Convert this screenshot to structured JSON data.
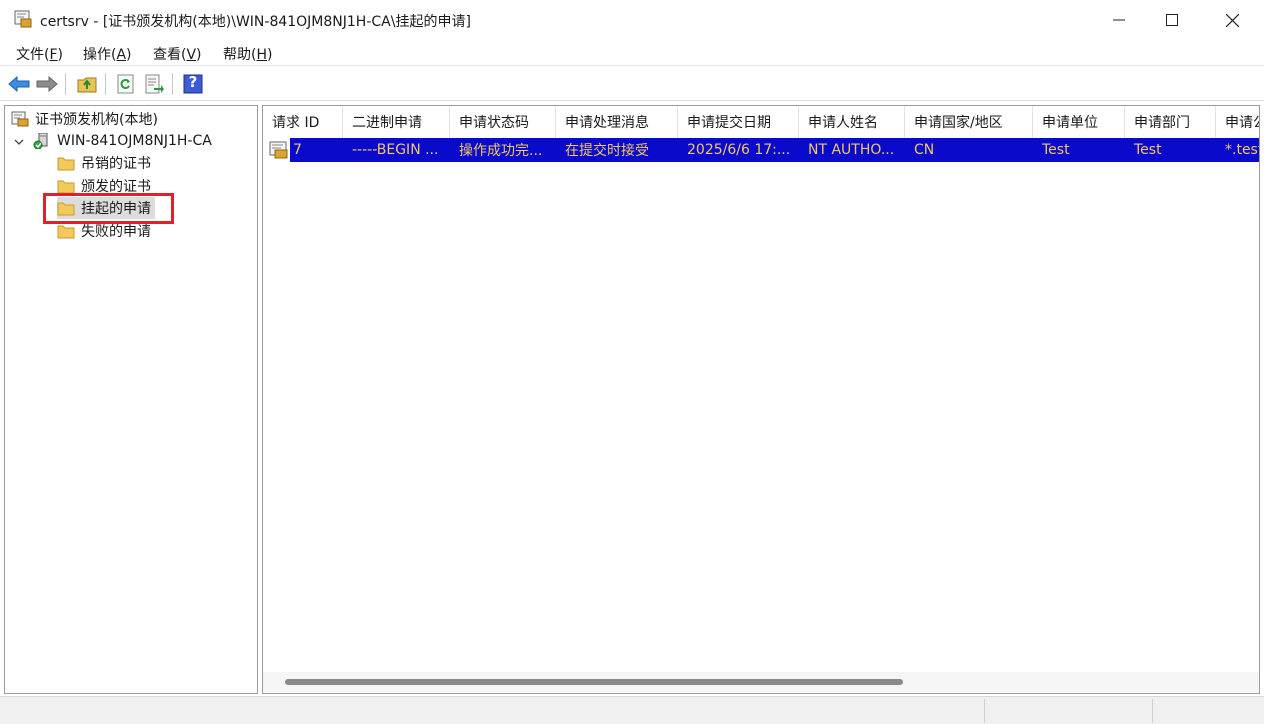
{
  "window": {
    "title": "certsrv - [证书颁发机构(本地)\\WIN-841OJM8NJ1H-CA\\挂起的申请]"
  },
  "menu": [
    {
      "label": "文件(",
      "key": "F",
      "end": ")"
    },
    {
      "label": "操作(",
      "key": "A",
      "end": ")"
    },
    {
      "label": "查看(",
      "key": "V",
      "end": ")"
    },
    {
      "label": "帮助(",
      "key": "H",
      "end": ")"
    }
  ],
  "toolbar": {
    "icons": [
      "back-arrow-icon",
      "forward-arrow-icon",
      "up-folder-icon",
      "refresh-icon",
      "export-list-icon",
      "help-icon"
    ],
    "help_glyph": "?"
  },
  "tree": {
    "root": "证书颁发机构(本地)",
    "ca": "WIN-841OJM8NJ1H-CA",
    "folders": [
      "吊销的证书",
      "颁发的证书",
      "挂起的申请",
      "失败的申请"
    ],
    "selected_index": 2
  },
  "list": {
    "columns": [
      "请求 ID",
      "二进制申请",
      "申请状态码",
      "申请处理消息",
      "申请提交日期",
      "申请人姓名",
      "申请国家/地区",
      "申请单位",
      "申请部门",
      "申请公"
    ],
    "rows": [
      [
        "7",
        "-----BEGIN ...",
        "操作成功完...",
        "在提交时接受",
        "2025/6/6 17:...",
        "NT AUTHO...",
        "CN",
        "Test",
        "Test",
        "*.test"
      ]
    ],
    "scroll_position": 0.62
  },
  "colors": {
    "selection": "#0a0acd",
    "selection_text": "#f4c760",
    "highlight": "#e0202a",
    "folder": "#f3c95b"
  }
}
